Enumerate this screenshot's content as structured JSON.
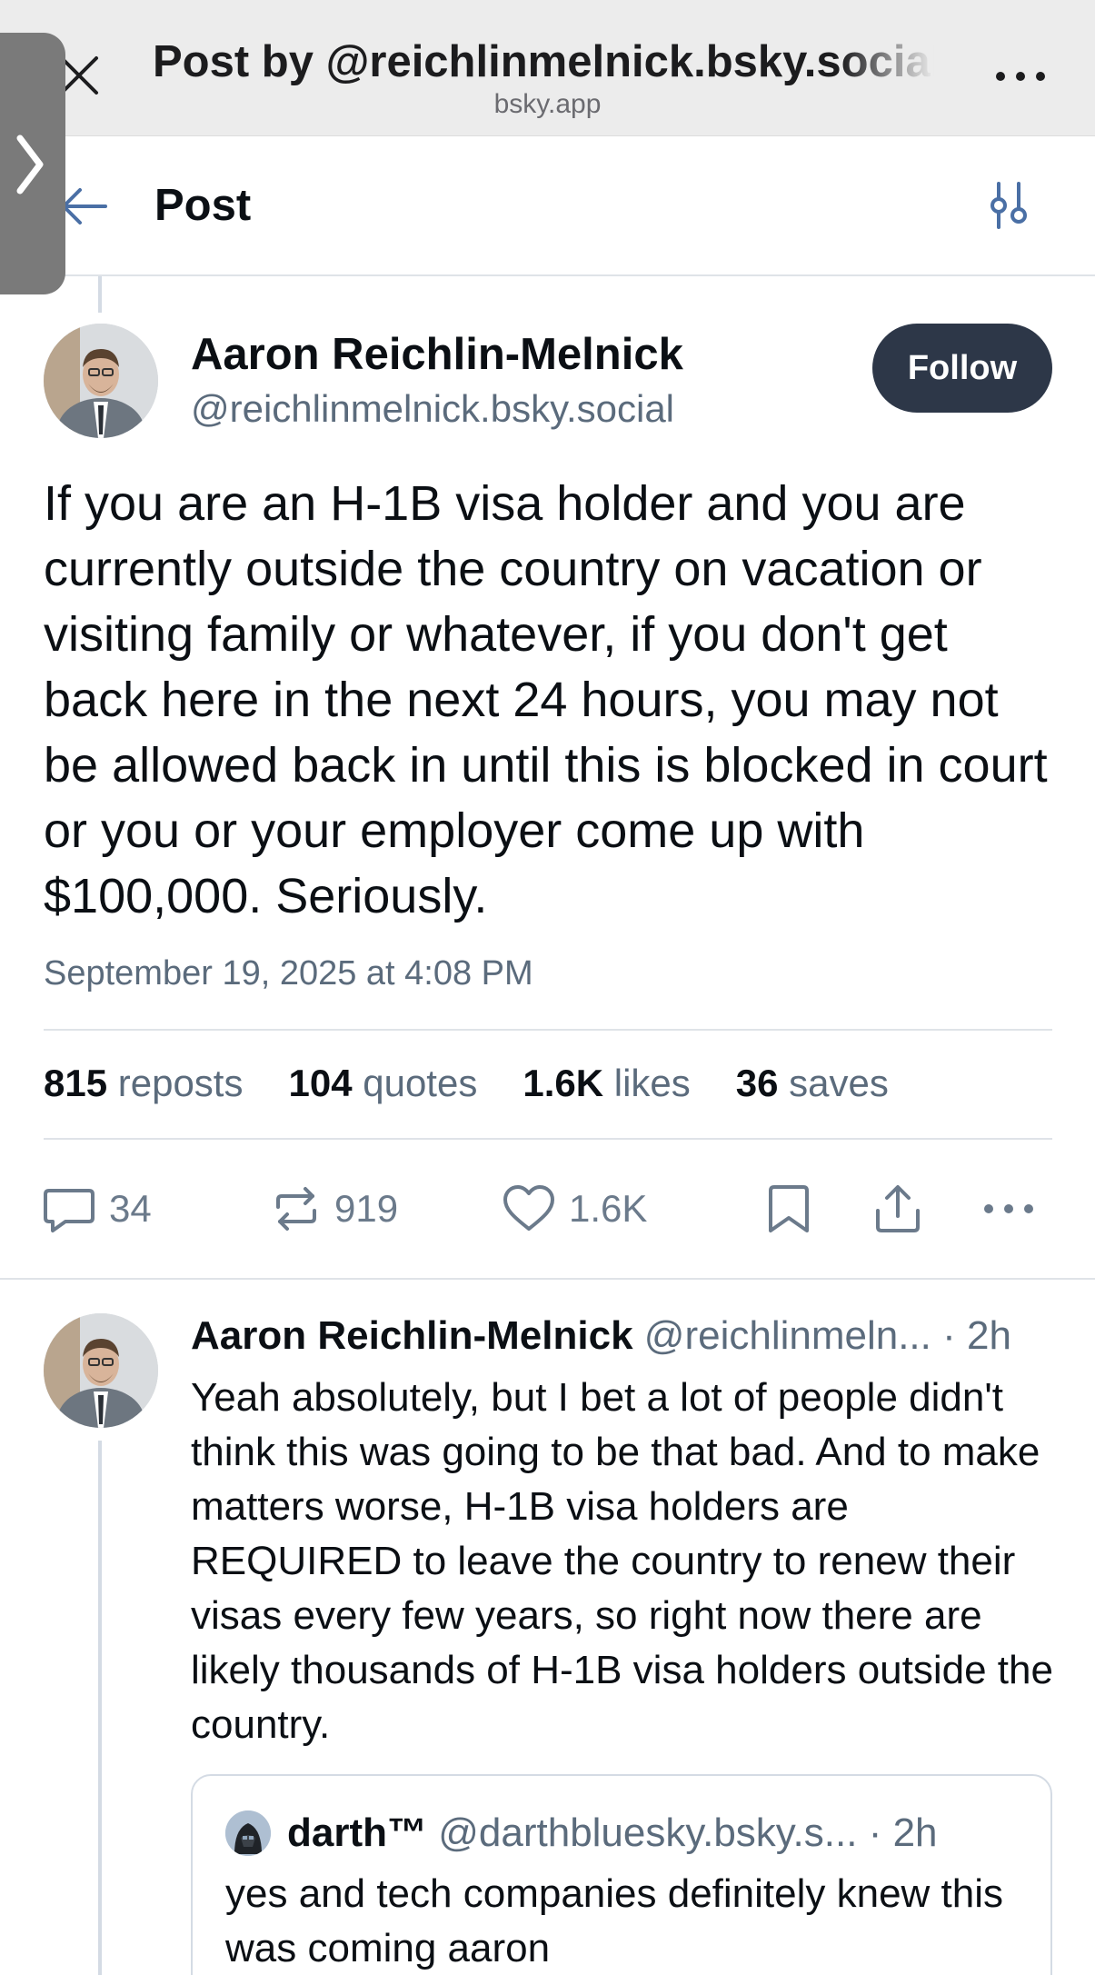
{
  "browser": {
    "title": "Post by @reichlinmelnick.bsky.social",
    "host": "bsky.app",
    "close_icon": "close-icon",
    "more_icon": "more-icon"
  },
  "header": {
    "title": "Post",
    "back_icon": "arrow-left-icon",
    "settings_icon": "sliders-icon"
  },
  "post": {
    "author_name": "Aaron Reichlin-Melnick",
    "author_handle": "@reichlinmelnick.bsky.social",
    "follow_label": "Follow",
    "text": "If you are an H-1B visa holder and you are currently outside the country on vacation or visiting family or whatever, if you don't get back here in the next 24 hours, you may not be allowed back in until this is blocked in court or you or your employer come up with $100,000. Seriously.",
    "date": "September 19, 2025 at 4:08 PM",
    "stats": {
      "reposts_count": "815",
      "reposts_label": "reposts",
      "quotes_count": "104",
      "quotes_label": "quotes",
      "likes_count": "1.6K",
      "likes_label": "likes",
      "saves_count": "36",
      "saves_label": "saves"
    },
    "actions": {
      "replies": "34",
      "reposts": "919",
      "likes": "1.6K"
    }
  },
  "reply": {
    "author_name": "Aaron Reichlin-Melnick",
    "author_handle": "@reichlinmeln...",
    "time": "· 2h",
    "text": "Yeah absolutely, but I bet a lot of people didn't think this was going to be that bad. And to make matters worse, H-1B visa holders are REQUIRED to leave the country to renew their visas every few years, so right now there are likely thousands of H-1B visa holders outside the country.",
    "quote": {
      "author_name": "darth™",
      "author_handle": "@darthbluesky.bsky.s...",
      "time": "· 2h",
      "text": "yes and tech companies definitely knew this was coming aaron"
    }
  },
  "colors": {
    "follow_bg": "#2d3748",
    "muted_text": "#5b6b7c",
    "divider": "#dfe3e8"
  }
}
